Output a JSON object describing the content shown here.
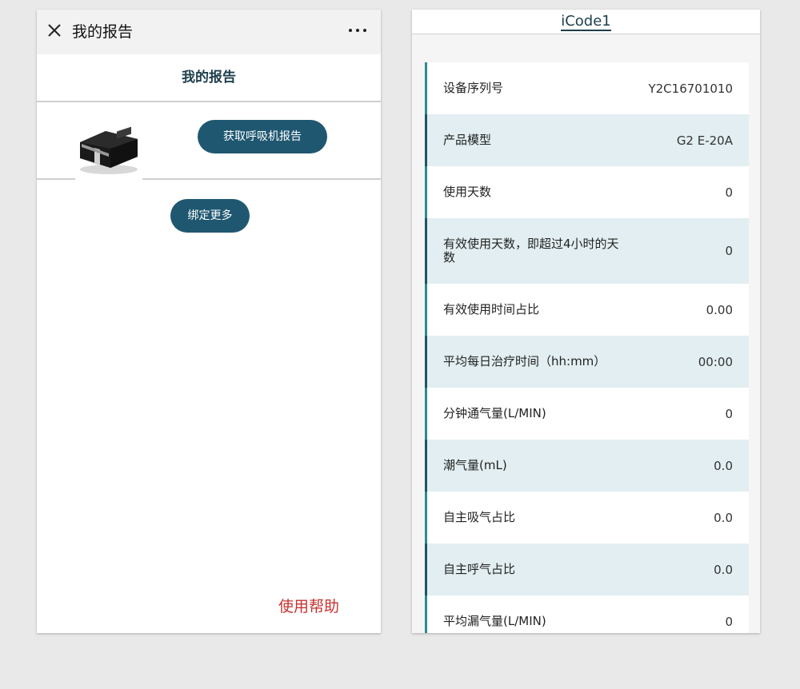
{
  "left": {
    "topbar": {
      "title": "我的报告"
    },
    "page_title": "我的报告",
    "report_button": "获取呼吸机报告",
    "bind_button": "绑定更多",
    "help_link": "使用帮助"
  },
  "right": {
    "title": "iCode1",
    "rows": [
      {
        "label": "设备序列号",
        "value": "Y2C16701010"
      },
      {
        "label": "产品模型",
        "value": "G2 E-20A"
      },
      {
        "label": "使用天数",
        "value": "0"
      },
      {
        "label": "有效使用天数，即超过4小时的天数",
        "value": "0"
      },
      {
        "label": "有效使用时间占比",
        "value": "0.00"
      },
      {
        "label": "平均每日治疗时间（hh:mm）",
        "value": "00:00"
      },
      {
        "label": "分钟通气量(L/MIN)",
        "value": "0"
      },
      {
        "label": "潮气量(mL)",
        "value": "0.0"
      },
      {
        "label": "自主吸气占比",
        "value": "0.0"
      },
      {
        "label": "自主呼气占比",
        "value": "0.0"
      },
      {
        "label": "平均漏气量(L/MIN)",
        "value": "0"
      }
    ]
  }
}
